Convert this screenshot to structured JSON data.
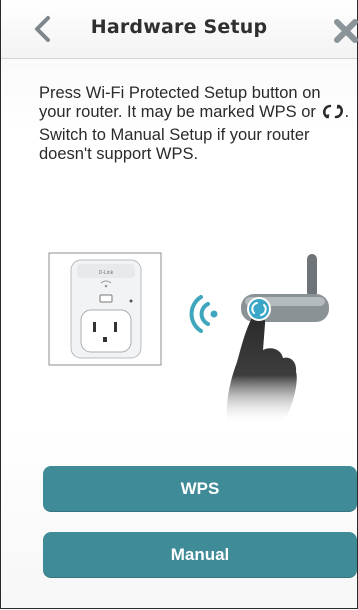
{
  "header": {
    "title": "Hardware Setup",
    "back_icon": "chevron-left-icon",
    "close_icon": "close-x-icon"
  },
  "instructions": {
    "line1_part1": "Press Wi-Fi Protected Setup button on your router. It may be marked WPS or",
    "line1_part2": ".",
    "wps_icon": "wps-icon",
    "line2": "Switch to Manual Setup if your router doesn't support WPS."
  },
  "illustration": {
    "plug_brand": "D-Link",
    "device": "smart-plug",
    "router": "router-with-wps-button",
    "signal_icon": "wireless-signal-icon"
  },
  "buttons": {
    "wps_label": "WPS",
    "manual_label": "Manual"
  },
  "colors": {
    "accent": "#3f8b97",
    "header_text": "#2f2f2f",
    "body_text": "#2a2a2a",
    "icon_gray": "#8a9499"
  }
}
